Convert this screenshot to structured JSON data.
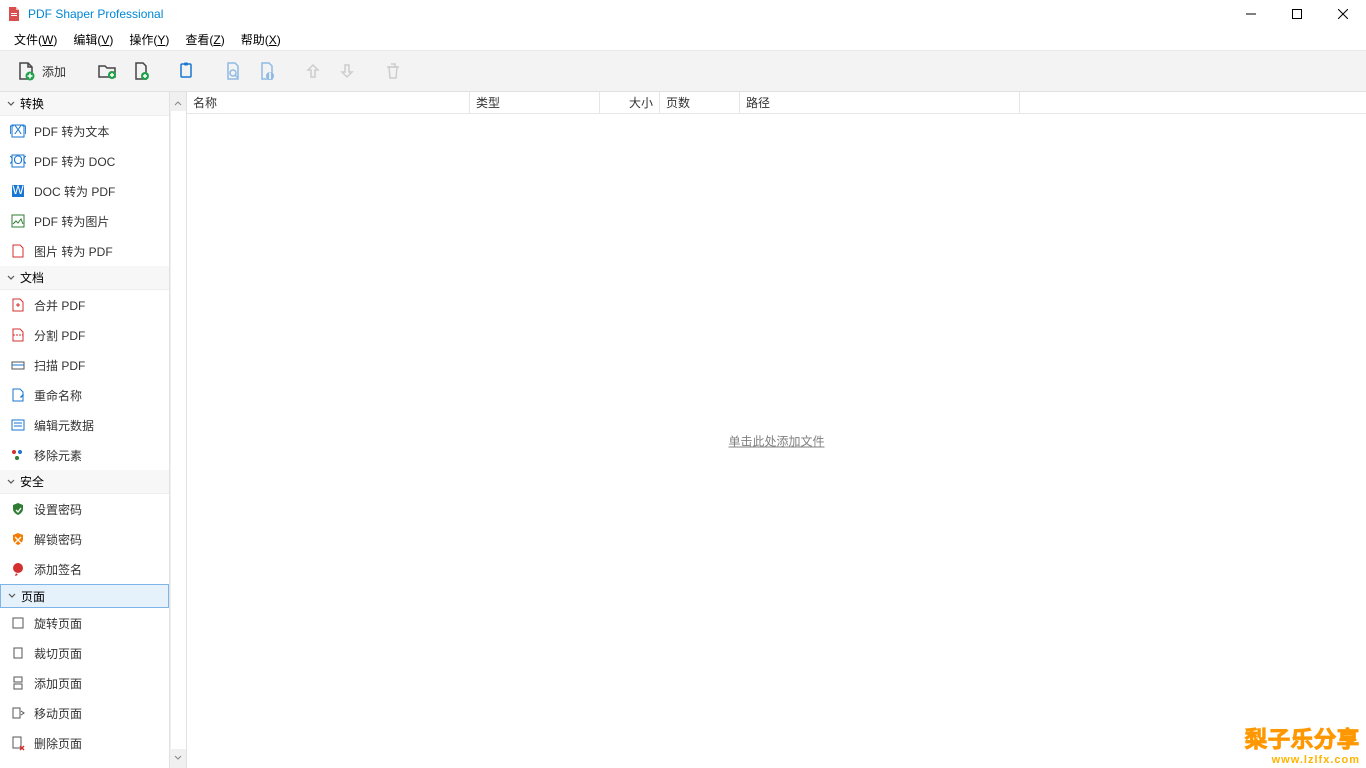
{
  "window": {
    "title": "PDF Shaper Professional"
  },
  "menu": {
    "file": "文件(",
    "file_k": "W",
    "file_e": ")",
    "edit": "编辑(",
    "edit_k": "V",
    "edit_e": ")",
    "action": "操作(",
    "action_k": "Y",
    "action_e": ")",
    "view": "查看(",
    "view_k": "Z",
    "view_e": ")",
    "help": "帮助(",
    "help_k": "X",
    "help_e": ")"
  },
  "toolbar": {
    "add": "添加"
  },
  "sidebar": {
    "groups": {
      "convert": "转换",
      "document": "文档",
      "security": "安全",
      "page": "页面"
    },
    "convert": [
      "PDF 转为文本",
      "PDF 转为 DOC",
      "DOC 转为 PDF",
      "PDF 转为图片",
      "图片 转为 PDF"
    ],
    "document": [
      "合并 PDF",
      "分割 PDF",
      "扫描 PDF",
      "重命名称",
      "编辑元数据",
      "移除元素"
    ],
    "security": [
      "设置密码",
      "解锁密码",
      "添加签名"
    ],
    "page": [
      "旋转页面",
      "裁切页面",
      "添加页面",
      "移动页面",
      "删除页面"
    ]
  },
  "columns": {
    "name": "名称",
    "type": "类型",
    "size": "大小",
    "pages": "页数",
    "path": "路径"
  },
  "placeholder": "单击此处添加文件",
  "watermark": {
    "line1": "梨子乐分享",
    "line2": "www.lzlfx.com"
  }
}
